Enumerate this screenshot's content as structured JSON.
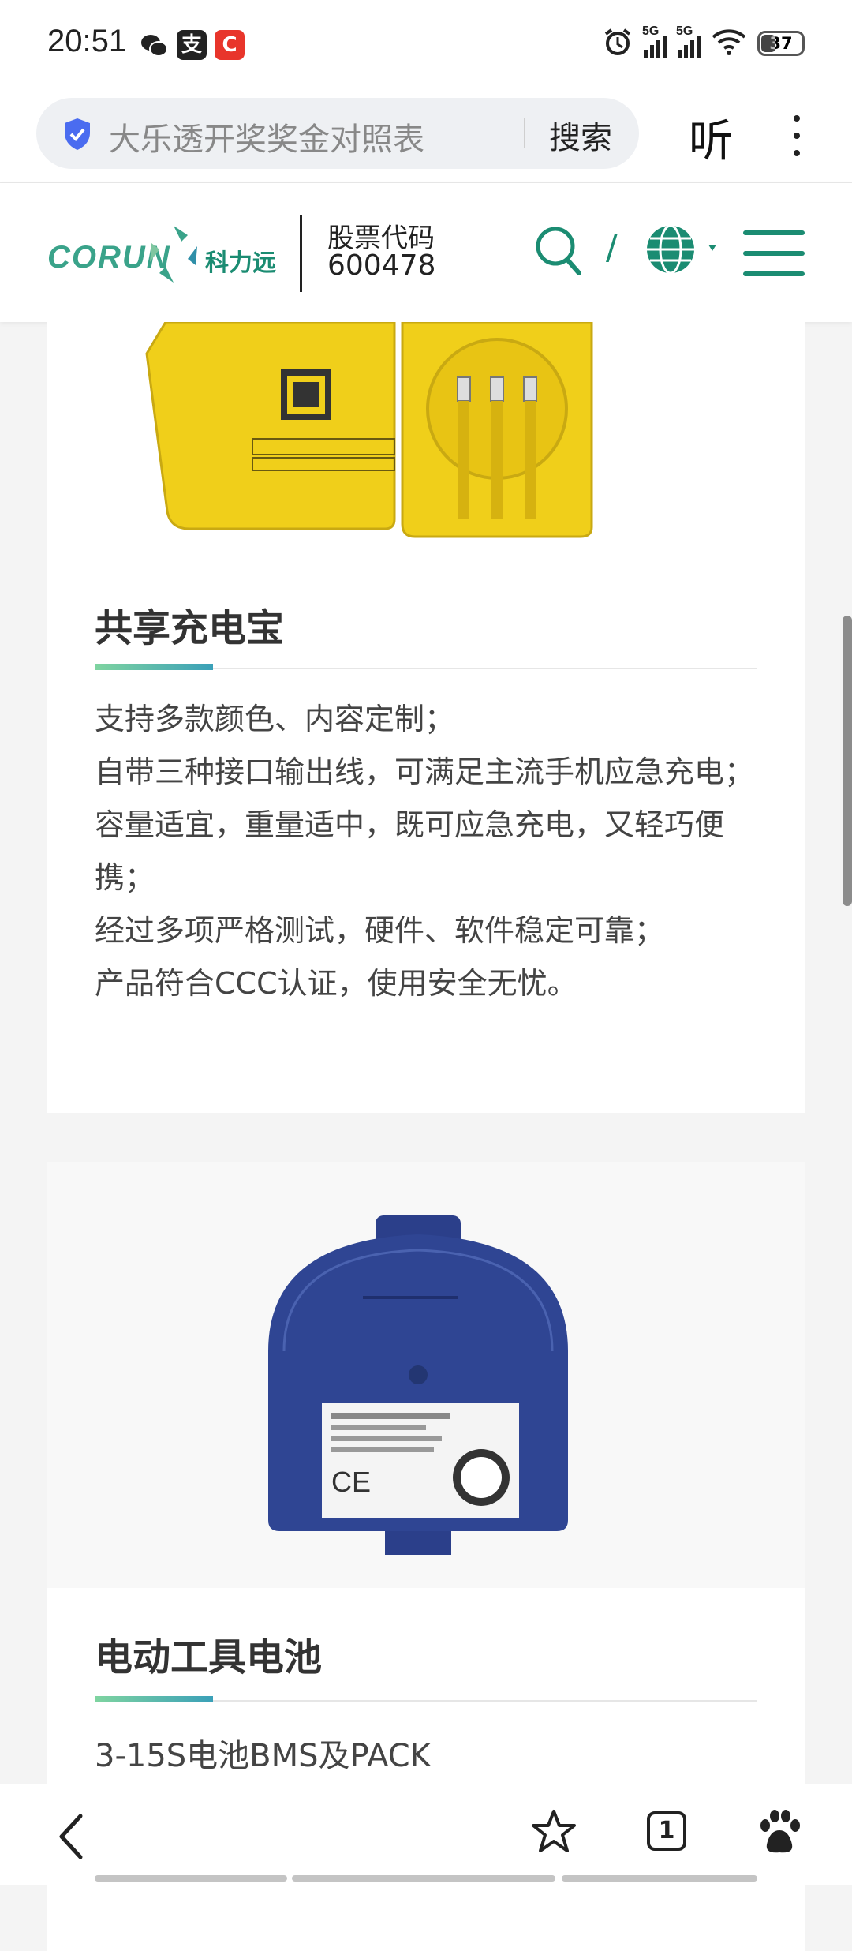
{
  "status_bar": {
    "time": "20:51",
    "app_icons": [
      "wechat-icon",
      "alipay-icon",
      "app-c-icon"
    ],
    "alipay_glyph": "支",
    "app_c_glyph": "C",
    "signal1_label": "5G",
    "signal2_label": "5G",
    "battery": "37"
  },
  "browser": {
    "search_query": "大乐透开奖奖金对照表",
    "search_button": "搜索",
    "listen_button": "听"
  },
  "site": {
    "logo_text": "CORUN",
    "logo_cn": "科力远",
    "stock_label": "股票代码",
    "stock_code": "600478",
    "slash": "/",
    "accent_color": "#1b8c72"
  },
  "products": [
    {
      "title": "共享充电宝",
      "features": [
        "支持多款颜色、内容定制；",
        "自带三种接口输出线，可满足主流手机应急充电；",
        "容量适宜，重量适中，既可应急充电，又轻巧便携；",
        "经过多项严格测试，硬件、软件稳定可靠；",
        "产品符合CCC认证，使用安全无忧。"
      ]
    },
    {
      "title": "电动工具电池",
      "subtitle": "3-15S电池BMS及PACK"
    }
  ],
  "bottom_nav": {
    "tabs_count": "1"
  }
}
